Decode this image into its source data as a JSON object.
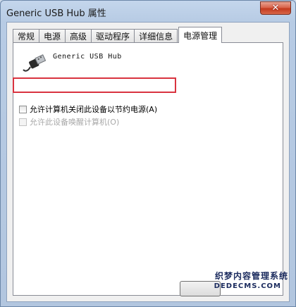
{
  "window": {
    "title": "Generic USB Hub 属性",
    "close_glyph": "✕"
  },
  "tabs": [
    {
      "label": "常规"
    },
    {
      "label": "电源"
    },
    {
      "label": "高级"
    },
    {
      "label": "驱动程序"
    },
    {
      "label": "详细信息"
    },
    {
      "label": "电源管理",
      "active": true
    }
  ],
  "device": {
    "icon": "usb-connector-icon",
    "name": "Generic USB Hub"
  },
  "options": [
    {
      "label": "允许计算机关闭此设备以节约电源(A)",
      "checked": false,
      "enabled": true
    },
    {
      "label": "允许此设备唤醒计算机(O)",
      "checked": false,
      "enabled": false
    }
  ],
  "watermark": {
    "text_cn": "织梦内容管理系统",
    "text_en": "DEDECMS.COM"
  },
  "colors": {
    "highlight": "#d9333f",
    "close_button": "#c43a1d"
  }
}
